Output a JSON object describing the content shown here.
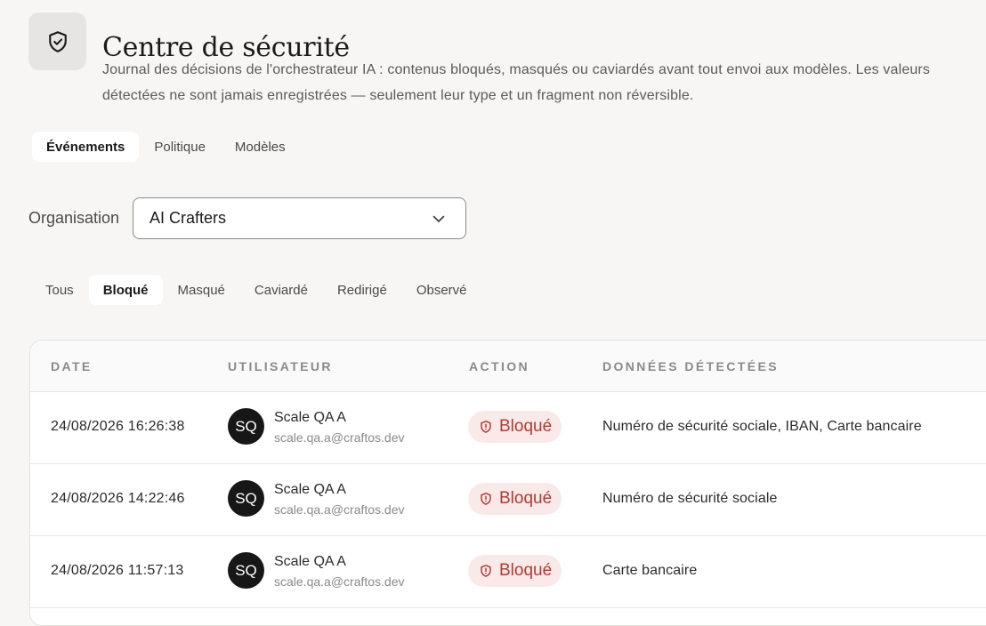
{
  "header": {
    "icon": "shield-check-icon",
    "title": "Centre de sécurité",
    "description": "Journal des décisions de l'orchestrateur IA : contenus bloqués, masqués ou caviardés avant tout envoi aux modèles. Les valeurs détectées ne sont jamais enregistrées — seulement leur type et un fragment non réversible."
  },
  "tabs": [
    {
      "label": "Événements",
      "active": true
    },
    {
      "label": "Politique",
      "active": false
    },
    {
      "label": "Modèles",
      "active": false
    }
  ],
  "organisation": {
    "label": "Organisation",
    "selected": "AI Crafters",
    "icon": "chevron-down-icon"
  },
  "filters": [
    {
      "label": "Tous",
      "active": false
    },
    {
      "label": "Bloqué",
      "active": true
    },
    {
      "label": "Masqué",
      "active": false
    },
    {
      "label": "Caviardé",
      "active": false
    },
    {
      "label": "Redirigé",
      "active": false
    },
    {
      "label": "Observé",
      "active": false
    }
  ],
  "table": {
    "columns": [
      "DATE",
      "UTILISATEUR",
      "ACTION",
      "DONNÉES DÉTECTÉES"
    ],
    "rows": [
      {
        "date": "24/08/2026 16:26:38",
        "initials": "SQ",
        "name": "Scale QA A",
        "email": "scale.qa.a@craftos.dev",
        "action": "Bloqué",
        "data": "Numéro de sécurité sociale, IBAN, Carte bancaire"
      },
      {
        "date": "24/08/2026 14:22:46",
        "initials": "SQ",
        "name": "Scale QA A",
        "email": "scale.qa.a@craftos.dev",
        "action": "Bloqué",
        "data": "Numéro de sécurité sociale"
      },
      {
        "date": "24/08/2026 11:57:13",
        "initials": "SQ",
        "name": "Scale QA A",
        "email": "scale.qa.a@craftos.dev",
        "action": "Bloqué",
        "data": "Carte bancaire"
      }
    ]
  },
  "colors": {
    "background": "#f7f6f4",
    "blocked_badge_bg": "#f9e9e8",
    "blocked_badge_text": "#b03a34",
    "avatar_bg": "#171717"
  }
}
